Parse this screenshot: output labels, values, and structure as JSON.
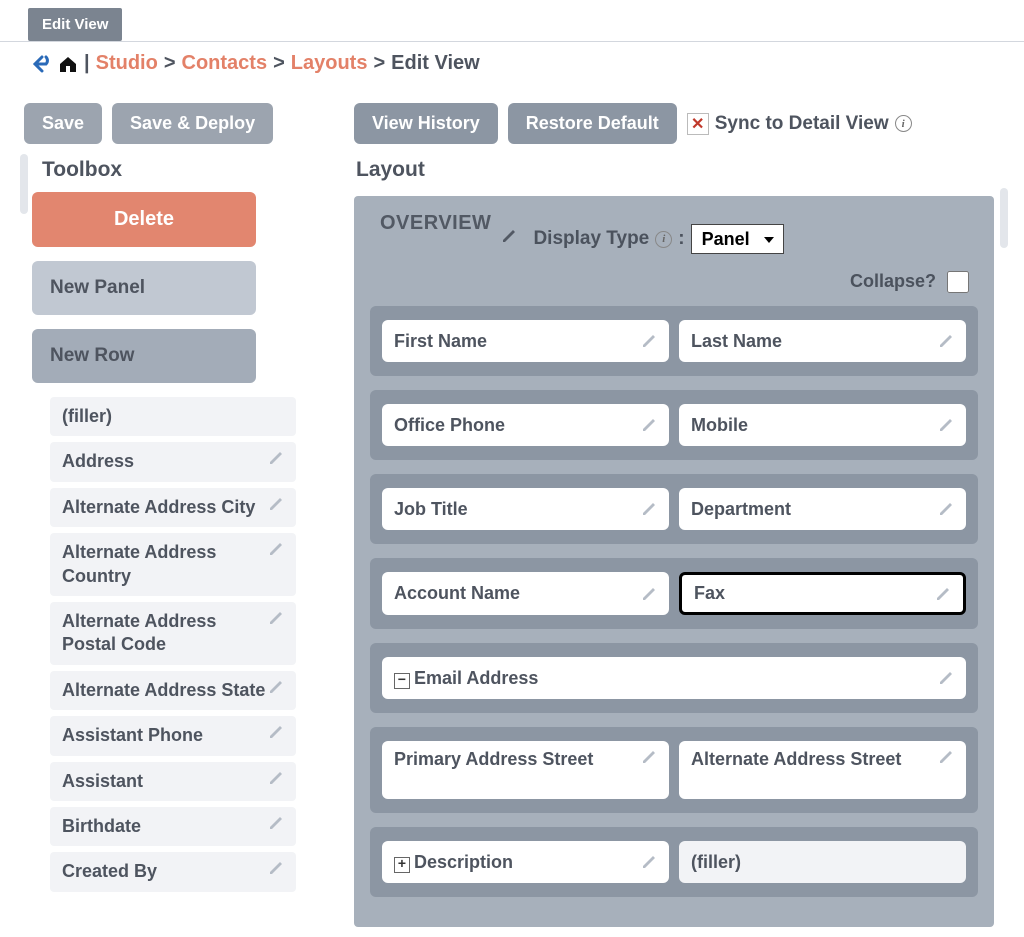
{
  "tab": {
    "label": "Edit View"
  },
  "breadcrumb": {
    "studio": "Studio",
    "module": "Contacts",
    "section": "Layouts",
    "page": "Edit View"
  },
  "buttons": {
    "save": "Save",
    "save_deploy": "Save & Deploy",
    "view_history": "View History",
    "restore_default": "Restore Default"
  },
  "sync_label": "Sync to Detail View",
  "toolbox": {
    "title": "Toolbox",
    "delete_label": "Delete",
    "new_panel_label": "New Panel",
    "new_row_label": "New Row",
    "items": [
      {
        "label": "(filler)",
        "editable": false
      },
      {
        "label": "Address",
        "editable": true
      },
      {
        "label": "Alternate Address City",
        "editable": true
      },
      {
        "label": "Alternate Address Country",
        "editable": true
      },
      {
        "label": "Alternate Address Postal Code",
        "editable": true
      },
      {
        "label": "Alternate Address State",
        "editable": true
      },
      {
        "label": "Assistant Phone",
        "editable": true
      },
      {
        "label": "Assistant",
        "editable": true
      },
      {
        "label": "Birthdate",
        "editable": true
      },
      {
        "label": "Created By",
        "editable": true
      }
    ]
  },
  "layout": {
    "title": "Layout",
    "panel_label": "OVERVIEW",
    "display_type_label": "Display Type",
    "display_type_value": "Panel",
    "collapse_label": "Collapse?",
    "collapse_checked": false,
    "rows": [
      {
        "cells": [
          {
            "label": "First Name"
          },
          {
            "label": "Last Name"
          }
        ]
      },
      {
        "cells": [
          {
            "label": "Office Phone"
          },
          {
            "label": "Mobile"
          }
        ]
      },
      {
        "cells": [
          {
            "label": "Job Title"
          },
          {
            "label": "Department"
          }
        ]
      },
      {
        "cells": [
          {
            "label": "Account Name"
          },
          {
            "label": "Fax",
            "highlight": true
          }
        ]
      },
      {
        "single": true,
        "cells": [
          {
            "label": "Email Address",
            "prefix": "minus"
          }
        ]
      },
      {
        "tall": true,
        "cells": [
          {
            "label": "Primary Address Street"
          },
          {
            "label": "Alternate Address Street"
          }
        ]
      },
      {
        "cells": [
          {
            "label": "Description",
            "prefix": "plus"
          },
          {
            "label": "(filler)",
            "filler": true
          }
        ]
      }
    ]
  }
}
